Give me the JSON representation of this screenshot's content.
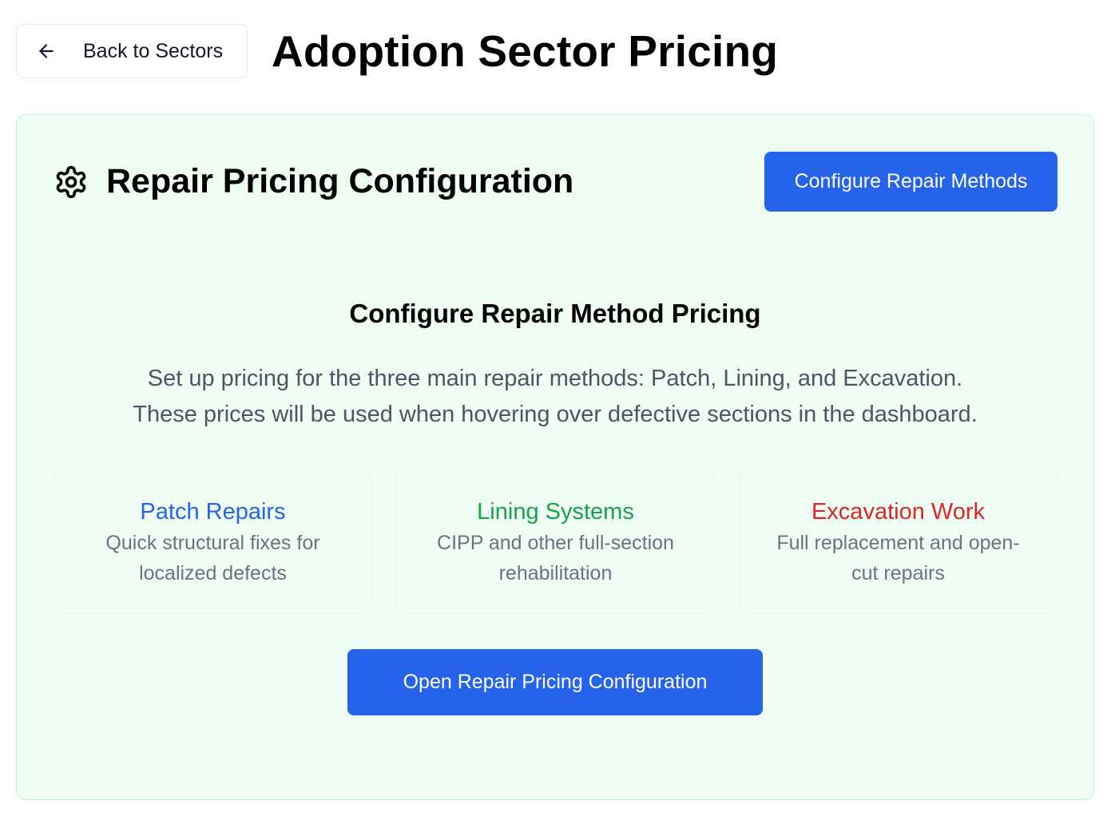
{
  "header": {
    "back_label": "Back to Sectors",
    "back_icon": "arrow-left-icon",
    "title": "Adoption Sector Pricing"
  },
  "card": {
    "icon": "gear-icon",
    "title": "Repair Pricing Configuration",
    "configure_button": "Configure Repair Methods",
    "section_title": "Configure Repair Method Pricing",
    "description_line1": "Set up pricing for the three main repair methods: Patch, Lining, and Excavation.",
    "description_line2": "These prices will be used when hovering over defective sections in the dashboard.",
    "methods": [
      {
        "title": "Patch Repairs",
        "description": "Quick structural fixes for localized defects",
        "color": "#2563eb"
      },
      {
        "title": "Lining Systems",
        "description": "CIPP and other full-section rehabilitation",
        "color": "#16a34a"
      },
      {
        "title": "Excavation Work",
        "description": "Full replacement and open-cut repairs",
        "color": "#dc2626"
      }
    ],
    "open_button": "Open Repair Pricing Configuration"
  },
  "colors": {
    "primary": "#2563eb",
    "card_bg": "#f0fdf4",
    "card_border": "#bbf7d0"
  }
}
